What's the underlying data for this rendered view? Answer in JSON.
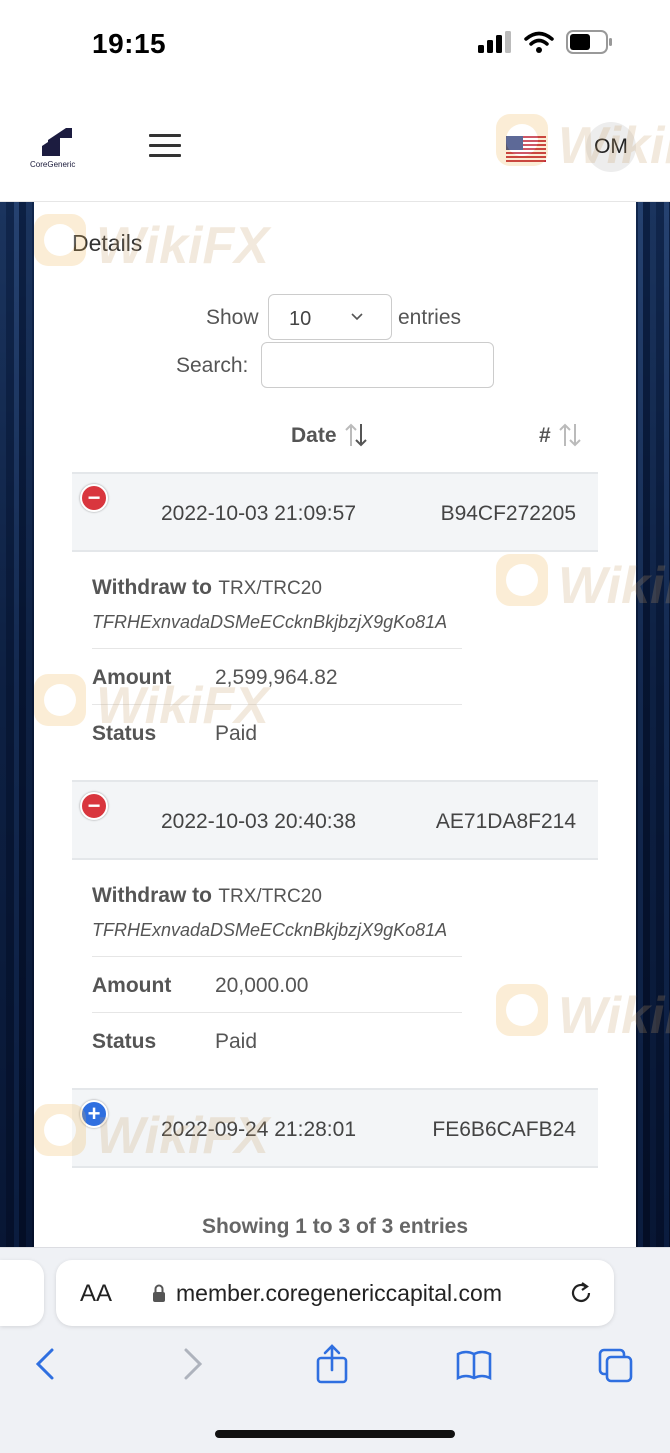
{
  "status_bar": {
    "time": "19:15"
  },
  "nav": {
    "brand": "CoreGeneric",
    "avatar_initials": "OM"
  },
  "page": {
    "title": "Details",
    "show_label": "Show",
    "show_value": "10",
    "entries_label": "entries",
    "search_label": "Search:",
    "search_value": "",
    "columns": {
      "date": "Date",
      "id": "#"
    },
    "rows": [
      {
        "date": "2022-10-03 21:09:57",
        "id": "B94CF272205",
        "expanded": true,
        "withdraw_label": "Withdraw to",
        "network": "TRX/TRC20",
        "address": "TFRHExnvadaDSMeECcknBkjbzjX9gKo81A",
        "amount_label": "Amount",
        "amount": "2,599,964.82",
        "status_label": "Status",
        "status": "Paid"
      },
      {
        "date": "2022-10-03 20:40:38",
        "id": "AE71DA8F214",
        "expanded": true,
        "withdraw_label": "Withdraw to",
        "network": "TRX/TRC20",
        "address": "TFRHExnvadaDSMeECcknBkjbzjX9gKo81A",
        "amount_label": "Amount",
        "amount": "20,000.00",
        "status_label": "Status",
        "status": "Paid"
      },
      {
        "date": "2022-09-24 21:28:01",
        "id": "FE6B6CAFB24",
        "expanded": false
      }
    ],
    "showing_text": "Showing 1 to 3 of 3 entries"
  },
  "watermark": {
    "text": "WikiFX"
  },
  "browser": {
    "aa_label": "AA",
    "url": "member.coregenericcapital.com"
  },
  "colors": {
    "minus": "#d9363e",
    "plus": "#2f6fe0",
    "row_bg": "#f3f5f7"
  }
}
